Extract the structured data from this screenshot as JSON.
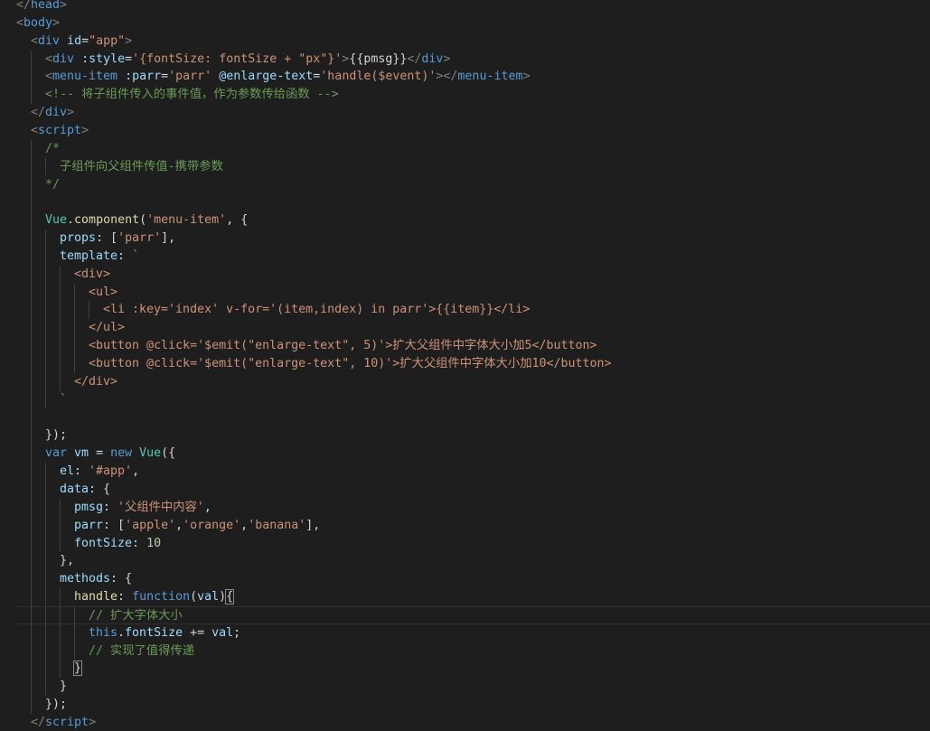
{
  "editor": {
    "language": "html",
    "theme": "dark",
    "lines": [
      {
        "indent": 0,
        "tokens": [
          [
            "ang",
            "</"
          ],
          [
            "tag",
            "head"
          ],
          [
            "ang",
            ">"
          ]
        ]
      },
      {
        "indent": 0,
        "tokens": [
          [
            "ang",
            "<"
          ],
          [
            "tag",
            "body"
          ],
          [
            "ang",
            ">"
          ]
        ]
      },
      {
        "indent": 1,
        "tokens": [
          [
            "ang",
            "<"
          ],
          [
            "tag",
            "div"
          ],
          [
            "txt",
            " "
          ],
          [
            "attr",
            "id"
          ],
          [
            "txt",
            "="
          ],
          [
            "str",
            "\"app\""
          ],
          [
            "ang",
            ">"
          ]
        ]
      },
      {
        "indent": 2,
        "tokens": [
          [
            "ang",
            "<"
          ],
          [
            "tag",
            "div"
          ],
          [
            "txt",
            " "
          ],
          [
            "attr",
            ":style"
          ],
          [
            "txt",
            "="
          ],
          [
            "str",
            "'{fontSize: fontSize + \"px\"}'"
          ],
          [
            "ang",
            ">"
          ],
          [
            "txt",
            "{{pmsg}}"
          ],
          [
            "ang",
            "</"
          ],
          [
            "tag",
            "div"
          ],
          [
            "ang",
            ">"
          ]
        ]
      },
      {
        "indent": 2,
        "tokens": [
          [
            "ang",
            "<"
          ],
          [
            "tag",
            "menu-item"
          ],
          [
            "txt",
            " "
          ],
          [
            "attr",
            ":parr"
          ],
          [
            "txt",
            "="
          ],
          [
            "str",
            "'parr'"
          ],
          [
            "txt",
            " "
          ],
          [
            "attr",
            "@enlarge-text"
          ],
          [
            "txt",
            "="
          ],
          [
            "str",
            "'handle($event)'"
          ],
          [
            "ang",
            "></"
          ],
          [
            "tag",
            "menu-item"
          ],
          [
            "ang",
            ">"
          ]
        ]
      },
      {
        "indent": 2,
        "tokens": [
          [
            "cmt",
            "<!-- 将子组件传入的事件值，作为参数传给函数 -->"
          ]
        ]
      },
      {
        "indent": 1,
        "tokens": [
          [
            "ang",
            "</"
          ],
          [
            "tag",
            "div"
          ],
          [
            "ang",
            ">"
          ]
        ]
      },
      {
        "indent": 1,
        "tokens": [
          [
            "ang",
            "<"
          ],
          [
            "tag",
            "script"
          ],
          [
            "ang",
            ">"
          ]
        ]
      },
      {
        "indent": 2,
        "tokens": [
          [
            "cmt",
            "/*"
          ]
        ]
      },
      {
        "indent": 3,
        "tokens": [
          [
            "cmt",
            "子组件向父组件传值-携带参数"
          ]
        ]
      },
      {
        "indent": 2,
        "tokens": [
          [
            "cmt",
            "*/"
          ]
        ]
      },
      {
        "indent": 0,
        "tokens": []
      },
      {
        "indent": 2,
        "tokens": [
          [
            "cls",
            "Vue"
          ],
          [
            "txt",
            "."
          ],
          [
            "fn",
            "component"
          ],
          [
            "txt",
            "("
          ],
          [
            "str",
            "'menu-item'"
          ],
          [
            "txt",
            ", {"
          ]
        ]
      },
      {
        "indent": 3,
        "tokens": [
          [
            "attr",
            "props"
          ],
          [
            "txt",
            ": ["
          ],
          [
            "str",
            "'parr'"
          ],
          [
            "txt",
            "],"
          ]
        ]
      },
      {
        "indent": 3,
        "tokens": [
          [
            "attr",
            "template"
          ],
          [
            "txt",
            ": "
          ],
          [
            "str",
            "`"
          ]
        ]
      },
      {
        "indent": 4,
        "tokens": [
          [
            "str",
            "<div>"
          ]
        ]
      },
      {
        "indent": 5,
        "tokens": [
          [
            "str",
            "<ul>"
          ]
        ]
      },
      {
        "indent": 6,
        "tokens": [
          [
            "str",
            "<li :key='index' v-for='(item,index) in parr'>{{item}}</li>"
          ]
        ]
      },
      {
        "indent": 5,
        "tokens": [
          [
            "str",
            "</ul>"
          ]
        ]
      },
      {
        "indent": 5,
        "tokens": [
          [
            "str",
            "<button @click='$emit(\"enlarge-text\", 5)'>扩大父组件中字体大小加5</button>"
          ]
        ]
      },
      {
        "indent": 5,
        "tokens": [
          [
            "str",
            "<button @click='$emit(\"enlarge-text\", 10)'>扩大父组件中字体大小加10</button>"
          ]
        ]
      },
      {
        "indent": 4,
        "tokens": [
          [
            "str",
            "</div>"
          ]
        ]
      },
      {
        "indent": 3,
        "tokens": [
          [
            "str",
            "`"
          ]
        ]
      },
      {
        "indent": 0,
        "tokens": []
      },
      {
        "indent": 2,
        "tokens": [
          [
            "txt",
            "});"
          ]
        ]
      },
      {
        "indent": 2,
        "tokens": [
          [
            "kw",
            "var"
          ],
          [
            "txt",
            " "
          ],
          [
            "attr",
            "vm"
          ],
          [
            "txt",
            " = "
          ],
          [
            "kw",
            "new"
          ],
          [
            "txt",
            " "
          ],
          [
            "cls",
            "Vue"
          ],
          [
            "txt",
            "({"
          ]
        ]
      },
      {
        "indent": 3,
        "tokens": [
          [
            "attr",
            "el"
          ],
          [
            "txt",
            ": "
          ],
          [
            "str",
            "'#app'"
          ],
          [
            "txt",
            ","
          ]
        ]
      },
      {
        "indent": 3,
        "tokens": [
          [
            "attr",
            "data"
          ],
          [
            "txt",
            ": {"
          ]
        ]
      },
      {
        "indent": 4,
        "tokens": [
          [
            "attr",
            "pmsg"
          ],
          [
            "txt",
            ": "
          ],
          [
            "str",
            "'父组件中内容'"
          ],
          [
            "txt",
            ","
          ]
        ]
      },
      {
        "indent": 4,
        "tokens": [
          [
            "attr",
            "parr"
          ],
          [
            "txt",
            ": ["
          ],
          [
            "str",
            "'apple'"
          ],
          [
            "txt",
            ","
          ],
          [
            "str",
            "'orange'"
          ],
          [
            "txt",
            ","
          ],
          [
            "str",
            "'banana'"
          ],
          [
            "txt",
            "],"
          ]
        ]
      },
      {
        "indent": 4,
        "tokens": [
          [
            "attr",
            "fontSize"
          ],
          [
            "txt",
            ": "
          ],
          [
            "num",
            "10"
          ]
        ]
      },
      {
        "indent": 3,
        "tokens": [
          [
            "txt",
            "},"
          ]
        ]
      },
      {
        "indent": 3,
        "tokens": [
          [
            "attr",
            "methods"
          ],
          [
            "txt",
            ": {"
          ]
        ]
      },
      {
        "indent": 4,
        "tokens": [
          [
            "fn",
            "handle"
          ],
          [
            "txt",
            ": "
          ],
          [
            "kw",
            "function"
          ],
          [
            "txt",
            "("
          ],
          [
            "attr",
            "val"
          ],
          [
            "txt",
            ")"
          ],
          [
            "brk",
            "{"
          ]
        ]
      },
      {
        "indent": 5,
        "tokens": [
          [
            "cmt",
            "// 扩大字体大小"
          ]
        ],
        "current": true
      },
      {
        "indent": 5,
        "tokens": [
          [
            "kw",
            "this"
          ],
          [
            "txt",
            "."
          ],
          [
            "attr",
            "fontSize"
          ],
          [
            "txt",
            " += "
          ],
          [
            "attr",
            "val"
          ],
          [
            "txt",
            ";"
          ]
        ]
      },
      {
        "indent": 5,
        "tokens": [
          [
            "cmt",
            "// 实现了值得传递"
          ]
        ]
      },
      {
        "indent": 4,
        "tokens": [
          [
            "brk",
            "}"
          ]
        ]
      },
      {
        "indent": 3,
        "tokens": [
          [
            "txt",
            "}"
          ]
        ]
      },
      {
        "indent": 2,
        "tokens": [
          [
            "txt",
            "});"
          ]
        ]
      },
      {
        "indent": 1,
        "tokens": [
          [
            "ang",
            "</"
          ],
          [
            "tag",
            "script"
          ],
          [
            "ang",
            ">"
          ]
        ]
      },
      {
        "indent": 0,
        "tokens": [
          [
            "ang",
            "</"
          ],
          [
            "tag",
            "body"
          ],
          [
            "ang",
            ">"
          ]
        ]
      }
    ]
  }
}
